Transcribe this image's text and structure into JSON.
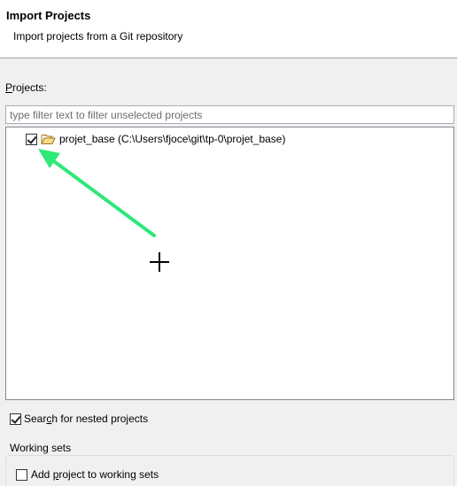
{
  "header": {
    "title": "Import Projects",
    "description": "Import projects from a Git repository"
  },
  "projects": {
    "label_mnemonic": "P",
    "label_rest": "rojects:",
    "filter_placeholder": "type filter text to filter unselected projects",
    "items": [
      {
        "label": "projet_base (C:\\Users\\fjoce\\git\\tp-0\\projet_base)",
        "checked": true,
        "icon": "open-folder-icon"
      }
    ]
  },
  "options": {
    "nested_label_pre": "Sear",
    "nested_label_mnemonic": "c",
    "nested_label_post": "h for nested projects",
    "nested_checked": true
  },
  "working_sets": {
    "title": "Working sets",
    "add_label_pre": "Add ",
    "add_label_mnemonic": "p",
    "add_label_post": "roject to working sets",
    "add_checked": false
  },
  "annotation": {
    "arrow_color": "#2ee878",
    "icons": [
      "arrow-annotation-icon",
      "crosshair-cursor-icon"
    ]
  }
}
